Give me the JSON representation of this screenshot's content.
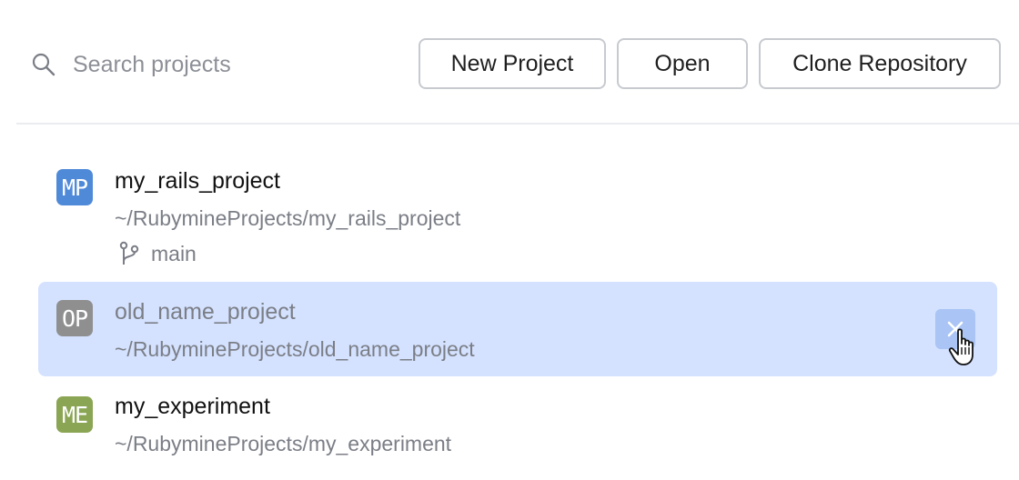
{
  "search": {
    "placeholder": "Search projects",
    "icon": "search-icon"
  },
  "toolbar": {
    "new_project_label": "New Project",
    "open_label": "Open",
    "clone_label": "Clone Repository"
  },
  "projects": [
    {
      "initials": "MP",
      "name": "my_rails_project",
      "path": "~/RubymineProjects/my_rails_project",
      "branch": "main",
      "avatar_color": "#4f8ad9"
    },
    {
      "initials": "OP",
      "name": "old_name_project",
      "path": "~/RubymineProjects/old_name_project",
      "avatar_color": "#8f8f8f",
      "selected": true
    },
    {
      "initials": "ME",
      "name": "my_experiment",
      "path": "~/RubymineProjects/my_experiment",
      "avatar_color": "#8aa553"
    }
  ],
  "colors": {
    "selection": "#d4e2ff",
    "remove_button": "#a9c4f5",
    "secondary_text": "#7b7e86"
  }
}
